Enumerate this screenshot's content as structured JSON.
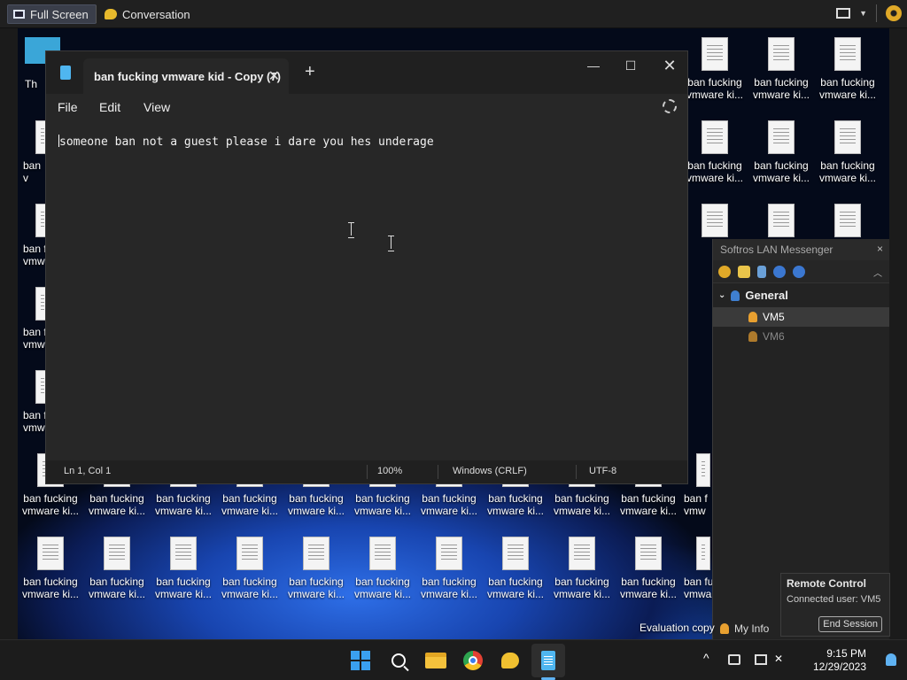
{
  "toolbar": {
    "fullscreen_label": "Full Screen",
    "conversation_label": "Conversation"
  },
  "desktop": {
    "icon_label_line1": "ban fucking",
    "icon_label_line2": "vmware ki...",
    "partial_first_label": "Th",
    "partial_ban": "ban f",
    "partial_vm": "vmw",
    "partial_ban2": "ban",
    "partial_v": "v",
    "partial_bot": "ban fu",
    "partial_bot2": "vmwar"
  },
  "notepad": {
    "tab_title": "ban fucking vmware kid - Copy (7)",
    "menu": {
      "file": "File",
      "edit": "Edit",
      "view": "View"
    },
    "content": "someone ban not a guest please i dare you hes underage",
    "status": {
      "position": "Ln 1, Col 1",
      "zoom": "100%",
      "line_ending": "Windows (CRLF)",
      "encoding": "UTF-8"
    }
  },
  "messenger": {
    "title": "Softros LAN Messenger",
    "group": "General",
    "users": [
      "VM5",
      "VM6"
    ],
    "my_info": "My Info"
  },
  "remote_control": {
    "title": "Remote Control",
    "connected": "Connected user: VM5",
    "end_button": "End Session"
  },
  "evaluation_text": "Evaluation copy",
  "clock": {
    "time": "9:15 PM",
    "date": "12/29/2023"
  },
  "colors": {
    "accent": "#5fb2f2",
    "notepad_bg": "#272727",
    "taskbar": "#1c1c1c"
  }
}
